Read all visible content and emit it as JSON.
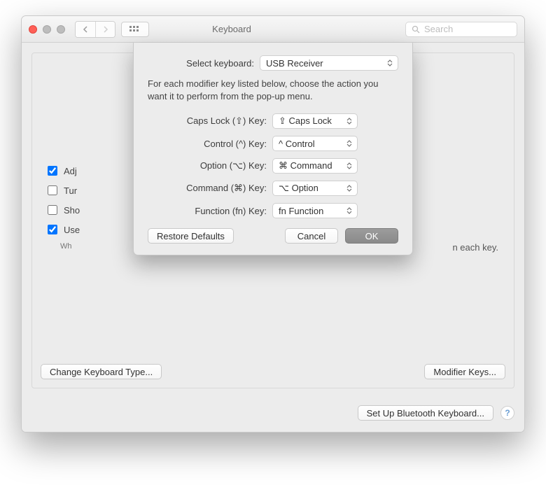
{
  "window": {
    "title": "Keyboard",
    "search_placeholder": "Search"
  },
  "background": {
    "checks": [
      {
        "checked": true,
        "label_fragment": "Adj"
      },
      {
        "checked": false,
        "label_fragment": "Tur"
      },
      {
        "checked": false,
        "label_fragment": "Sho"
      },
      {
        "checked": true,
        "label_fragment": "Use"
      }
    ],
    "use_subtext_left": "Wh",
    "use_subtext_right": "n each key."
  },
  "panel_buttons": {
    "change_type": "Change Keyboard Type...",
    "modifier_keys": "Modifier Keys..."
  },
  "footer": {
    "setup_bluetooth": "Set Up Bluetooth Keyboard..."
  },
  "sheet": {
    "select_keyboard_label": "Select keyboard:",
    "select_keyboard_value": "USB Receiver",
    "description": "For each modifier key listed below, choose the action you want it to perform from the pop-up menu.",
    "keys": [
      {
        "label": "Caps Lock (⇪) Key:",
        "value": "⇪ Caps Lock"
      },
      {
        "label": "Control (^) Key:",
        "value": "^ Control"
      },
      {
        "label": "Option (⌥) Key:",
        "value": "⌘ Command"
      },
      {
        "label": "Command (⌘) Key:",
        "value": "⌥ Option"
      },
      {
        "label": "Function (fn) Key:",
        "value": "fn Function"
      }
    ],
    "buttons": {
      "restore": "Restore Defaults",
      "cancel": "Cancel",
      "ok": "OK"
    }
  }
}
